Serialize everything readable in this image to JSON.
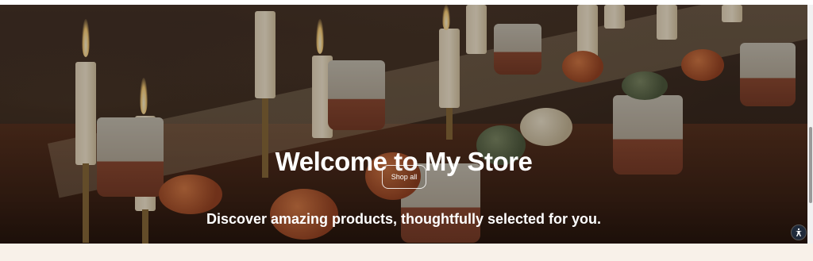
{
  "hero": {
    "title": "Welcome to My Store",
    "button_label": "Shop all",
    "subtitle": "Discover amazing products, thoughtfully selected for you."
  },
  "widgets": {
    "accessibility_icon": "accessibility-icon"
  },
  "colors": {
    "page_background": "#f8f1e9",
    "hero_text": "#ffffff"
  }
}
